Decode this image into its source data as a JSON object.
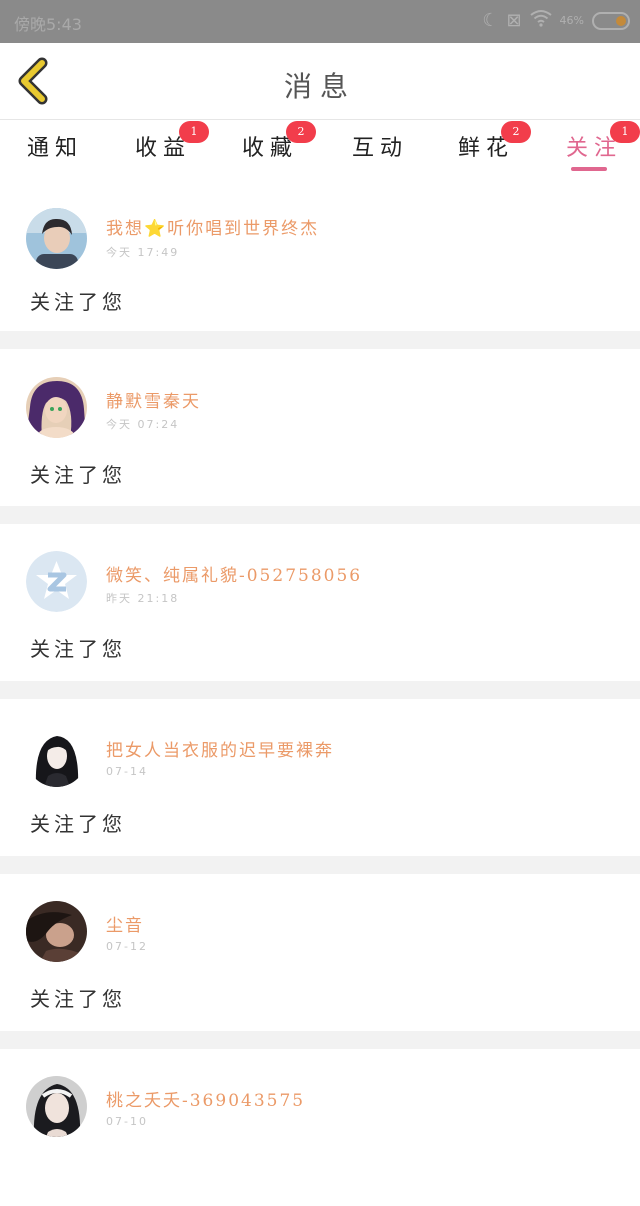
{
  "status_bar": {
    "time": "傍晚5:43",
    "battery": "46%"
  },
  "header": {
    "title": "消息"
  },
  "tabs": [
    {
      "label": "通知",
      "badge": ""
    },
    {
      "label": "收益",
      "badge": "1"
    },
    {
      "label": "收藏",
      "badge": "2"
    },
    {
      "label": "互动",
      "badge": ""
    },
    {
      "label": "鲜花",
      "badge": "2"
    },
    {
      "label": "关注",
      "badge": "1",
      "active": true
    }
  ],
  "feed": [
    {
      "user": "我想⭐听你唱到世界终杰",
      "time": "今天 17:49",
      "action": "关注了您",
      "avatar": "boy-photo"
    },
    {
      "user": "静默雪秦天",
      "time": "今天 07:24",
      "action": "关注了您",
      "avatar": "anime-girl"
    },
    {
      "user": "微笑、纯属礼貌-052758056",
      "time": "昨天 21:18",
      "action": "关注了您",
      "avatar": "default-z"
    },
    {
      "user": "把女人当衣服的迟早要裸奔",
      "time": "07-14",
      "action": "关注了您",
      "avatar": "black-hair-girl"
    },
    {
      "user": "尘音",
      "time": "07-12",
      "action": "关注了您",
      "avatar": "dark-girl"
    },
    {
      "user": "桃之夭夭-369043575",
      "time": "07-10",
      "action": "",
      "avatar": "woman-photo"
    }
  ],
  "colors": {
    "accent": "#e0678f",
    "username": "#eb9a68",
    "badge": "#f23d4b",
    "back": "#e8c930"
  }
}
